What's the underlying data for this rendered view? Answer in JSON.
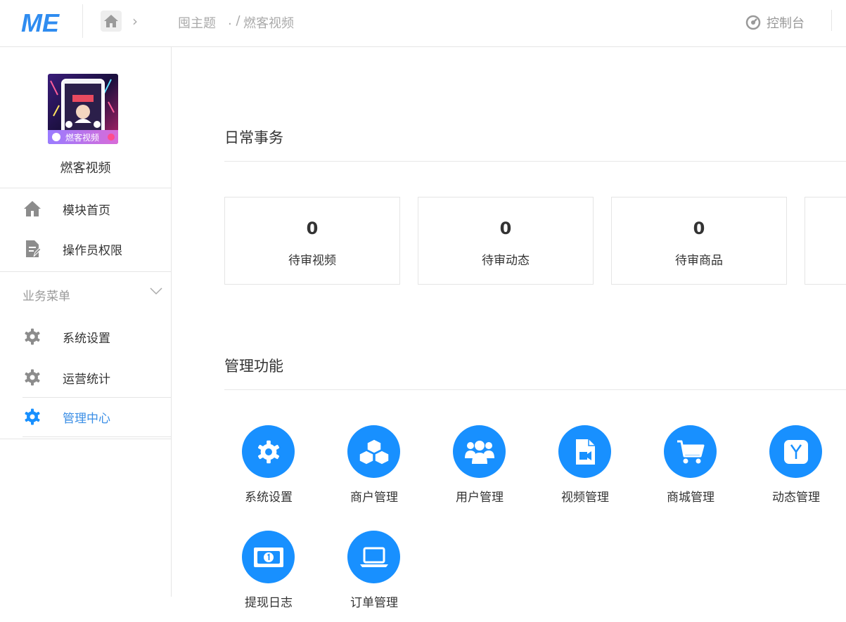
{
  "header": {
    "logo_text": "ME",
    "breadcrumb_root": "囤主题",
    "breadcrumb_sep": ". /",
    "breadcrumb_current": "燃客视频",
    "console_label": "控制台"
  },
  "sidebar": {
    "app_name": "燃客视频",
    "app_badge": "燃客视频",
    "top_items": [
      {
        "label": "模块首页",
        "icon": "home-icon"
      },
      {
        "label": "操作员权限",
        "icon": "document-edit-icon"
      }
    ],
    "section_title": "业务菜单",
    "menu_items": [
      {
        "label": "系统设置",
        "icon": "gear-icon"
      },
      {
        "label": "运营统计",
        "icon": "gear-icon"
      },
      {
        "label": "管理中心",
        "icon": "gear-icon",
        "active": true
      }
    ]
  },
  "main": {
    "daily_title": "日常事务",
    "stats": [
      {
        "value": "0",
        "label": "待审视频"
      },
      {
        "value": "0",
        "label": "待审动态"
      },
      {
        "value": "0",
        "label": "待审商品"
      }
    ],
    "manage_title": "管理功能",
    "functions": [
      {
        "label": "系统设置",
        "icon": "gear-icon"
      },
      {
        "label": "商户管理",
        "icon": "boxes-icon"
      },
      {
        "label": "用户管理",
        "icon": "users-icon"
      },
      {
        "label": "视频管理",
        "icon": "video-file-icon"
      },
      {
        "label": "商城管理",
        "icon": "cart-icon"
      },
      {
        "label": "动态管理",
        "icon": "y-square-icon"
      },
      {
        "label": "提现日志",
        "icon": "money-icon"
      },
      {
        "label": "订单管理",
        "icon": "laptop-icon"
      }
    ]
  },
  "colors": {
    "accent": "#1890ff",
    "active_text": "#3a8ee6",
    "logo": "#2f8cf0"
  }
}
